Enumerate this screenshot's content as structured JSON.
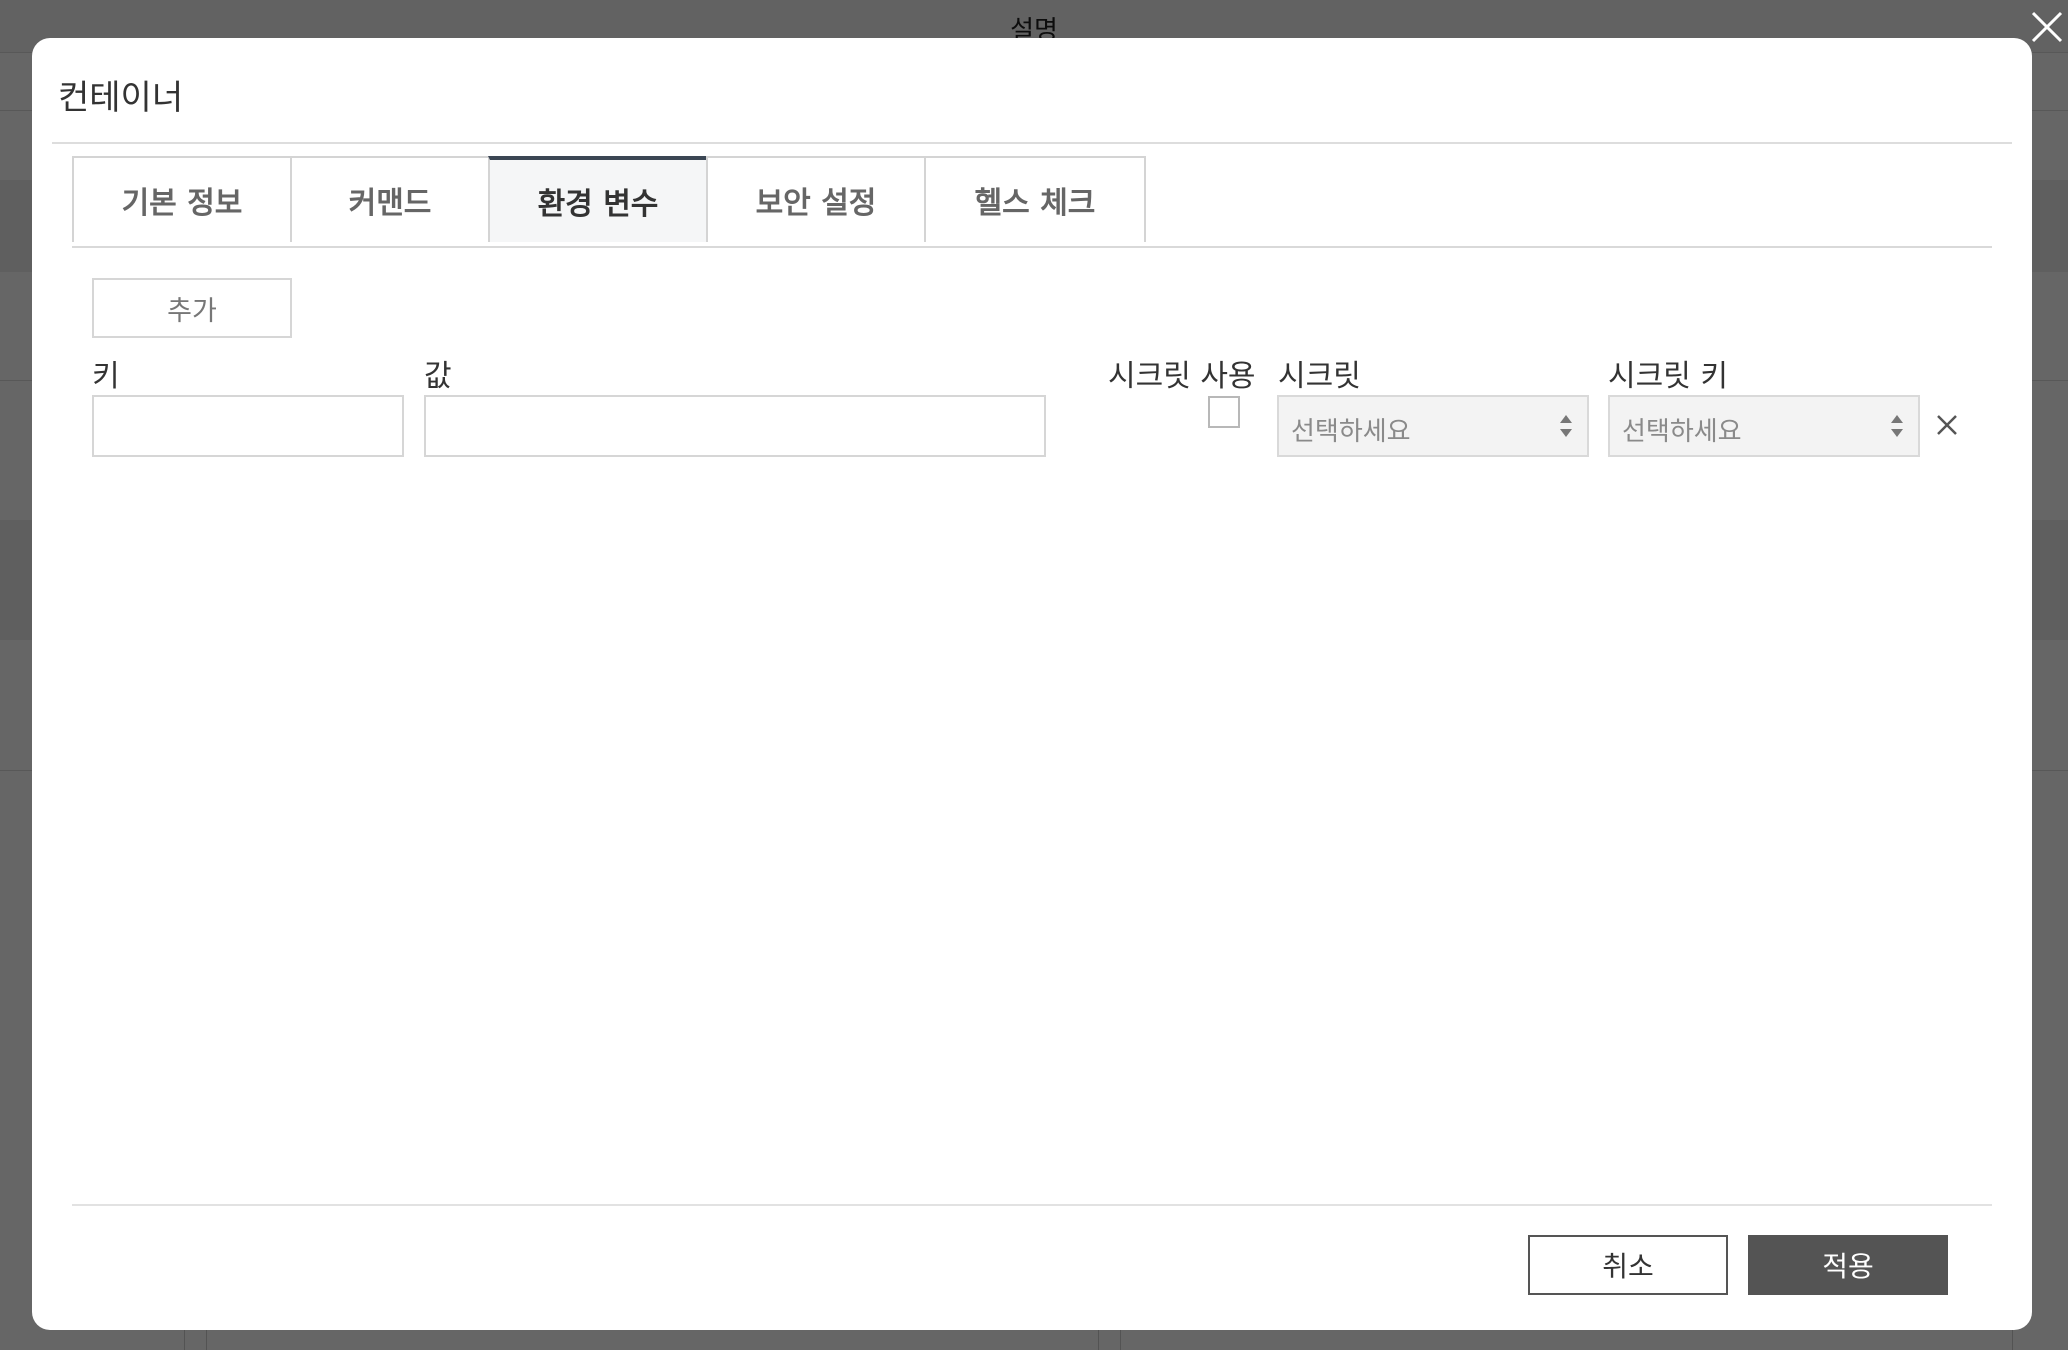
{
  "background": {
    "header_title": "설명"
  },
  "modal": {
    "title": "컨테이너",
    "tabs": [
      {
        "label": "기본 정보",
        "active": false
      },
      {
        "label": "커맨드",
        "active": false
      },
      {
        "label": "환경 변수",
        "active": true
      },
      {
        "label": "보안 설정",
        "active": false
      },
      {
        "label": "헬스 체크",
        "active": false
      }
    ],
    "env": {
      "add_label": "추가",
      "key_label": "키",
      "value_label": "값",
      "use_secret_label": "시크릿 사용",
      "secret_label": "시크릿",
      "secret_key_label": "시크릿 키",
      "key_value": "",
      "value_value": "",
      "use_secret_checked": false,
      "secret_selected": "선택하세요",
      "secret_key_selected": "선택하세요"
    },
    "footer": {
      "cancel_label": "취소",
      "apply_label": "적용"
    }
  },
  "colors": {
    "active_tab_border": "#3b4654",
    "apply_button": "#545454"
  },
  "icons": {
    "overlay_close": "close-icon",
    "row_remove": "close-icon",
    "select_arrows": "sort-arrows-icon"
  }
}
